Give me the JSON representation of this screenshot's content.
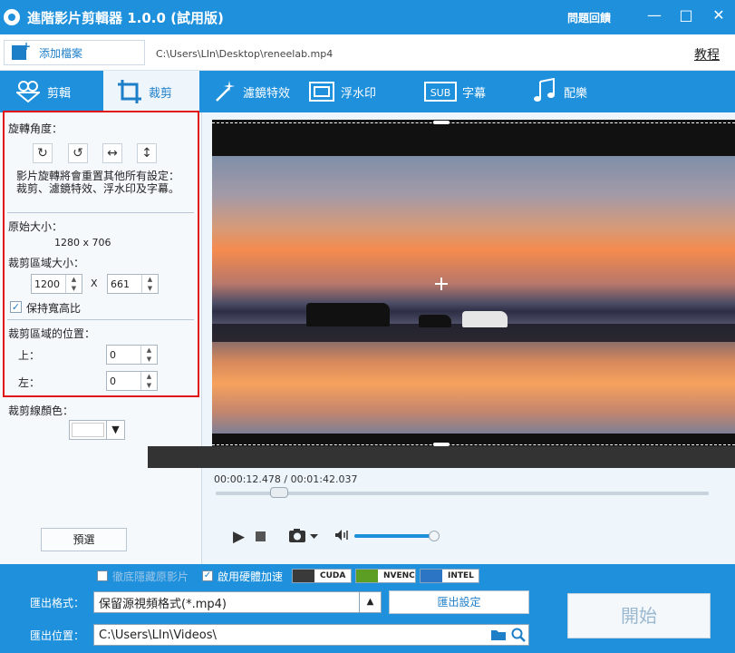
{
  "window": {
    "title": "進階影片剪輯器 1.0.0 (試用版)",
    "feedback": "問題回饋",
    "min": "—",
    "max": "□",
    "close": "✕"
  },
  "topbar": {
    "add_file": "添加檔案",
    "file_path": "C:\\Users\\LIn\\Desktop\\reneelab.mp4",
    "tutorial": "教程"
  },
  "tabs": [
    {
      "label": "剪輯",
      "icon": "clip-icon"
    },
    {
      "label": "裁剪",
      "icon": "crop-icon",
      "active": true
    },
    {
      "label": "濾鏡特效",
      "icon": "magic-wand-icon"
    },
    {
      "label": "浮水印",
      "icon": "watermark-icon"
    },
    {
      "label": "字幕",
      "icon": "subtitle-icon",
      "badge": "SUB"
    },
    {
      "label": "配樂",
      "icon": "music-icon"
    }
  ],
  "left": {
    "rotate_title": "旋轉角度：",
    "rotate_note": "影片旋轉將會重置其他所有設定：裁剪、濾鏡特效、浮水印及字幕。",
    "original_size_title": "原始大小：",
    "original_size": "1280 x 706",
    "crop_size_title": "裁剪區域大小：",
    "crop_width": "1200",
    "crop_x": "X",
    "crop_height": "661",
    "keep_ratio": "保持寬高比",
    "keep_ratio_checked": true,
    "crop_pos_title": "裁剪區域的位置：",
    "top_label": "上：",
    "top_value": "0",
    "left_label": "左：",
    "left_value": "0",
    "line_color_title": "裁剪線顏色：",
    "line_color": "#ffffff",
    "preset": "預選"
  },
  "player": {
    "time": "00:00:12.478 / 00:01:42.037",
    "progress": 0.13,
    "volume": 0.9
  },
  "bottom": {
    "deinterlace": "徹底隱藏原影片",
    "deinterlace_checked": false,
    "hw_accel": "啟用硬體加速",
    "hw_accel_checked": true,
    "gpu": [
      "CUDA",
      "NVENC",
      "INTEL"
    ],
    "format_label": "匯出格式：",
    "format_value": "保留源視頻格式(*.mp4)",
    "export_settings": "匯出設定",
    "location_label": "匯出位置：",
    "location_value": "C:\\Users\\LIn\\Videos\\",
    "start": "開始"
  }
}
